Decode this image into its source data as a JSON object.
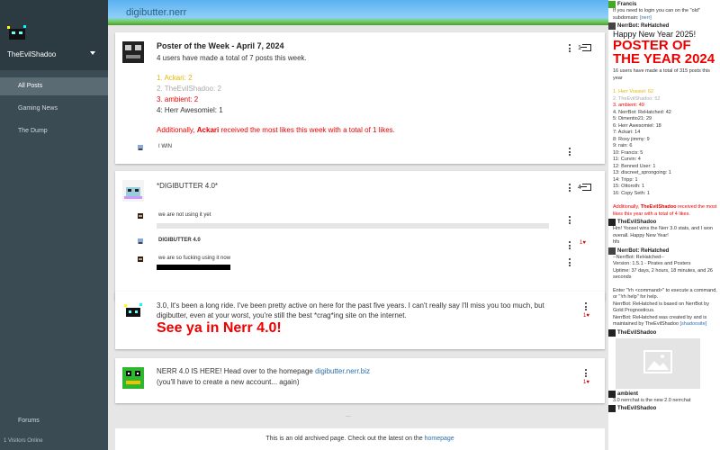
{
  "sidebar": {
    "username": "TheEvilShadoo",
    "nav": [
      {
        "label": "All Posts"
      },
      {
        "label": "Gaming News"
      },
      {
        "label": "The Dump"
      }
    ],
    "forums": "Forums",
    "visitors": "1 Visitors Online"
  },
  "header": {
    "title": "digibutter.nerr"
  },
  "posts": [
    {
      "title": "Poster of the Week - April 7, 2024",
      "intro": "4 users have made a total of 7 posts this week.",
      "rank1": "1. Ackari: 2",
      "rank2": "2. TheEvilShadoo: 2",
      "rank3": "3. ambient: 2",
      "rank4": "4: Herr Awesomiel: 1",
      "most_likes_pre": "Additionally,",
      "most_likes_name": "Ackari",
      "most_likes_post": "received the most likes this week with a total of 1 likes.",
      "share_count": "1",
      "reply_text": "I WIN"
    },
    {
      "title": "*DIGIBUTTER 4.0*",
      "share_count": "4",
      "replies": [
        {
          "text": "we are not using it yet"
        },
        {
          "text": "DIGIBUTTER 4.0",
          "likes": "1"
        },
        {
          "text": "we are so fucking using it now"
        }
      ],
      "more": "..."
    },
    {
      "text": "3.0, It's been a long ride. I've been pretty active on here for the past five years. I can't really say I'll miss you too much, but digibutter, even at your worst, you're still the best *crag*ing site on the internet.",
      "big": "See ya in Nerr 4.0!",
      "likes": "1"
    },
    {
      "text_pre": "NERR 4.0 IS HERE! Head over to the homepage",
      "link": "digibutter.nerr.biz",
      "text2": "(you'll have to create a new account... again)",
      "likes": "1"
    }
  ],
  "feed_more": "...",
  "footer": {
    "text": "This is an old archived page. Check out the latest on the",
    "link": "homepage"
  },
  "chat": {
    "m1_user": "Francis",
    "m1_text": "If you need to login you can on the \"old\" subdomain:",
    "m1_link": "[nerr]",
    "m2_user": "NerrBot: ReHatched",
    "m2_hny": "Happy New Year 2025!",
    "m2_big": "POSTER OF THE YEAR 2024",
    "m2_intro": "16 users have made a total of 315 posts this year",
    "ranks": [
      "1. Herr Vossiel: 62",
      "2. TheEvilShadoo: 52",
      "3. ambient: 49",
      "4. NerrBot: ReHatched: 42",
      "5: Dimentio21: 29",
      "6: Herr Awesomiel: 18",
      "7: Ackari: 14",
      "8: Roxy jimmy: 9",
      "9: rain: 6",
      "10: Francis: 5",
      "11: Curvin: 4",
      "12: Benned User: 1",
      "13: discreet_sprongoing: 1",
      "14: Tripp: 1",
      "15: Ottoroth: 1",
      "16: Copy Seth: 1"
    ],
    "m2_likes_pre": "Additionally,",
    "m2_likes_name": "TheEvilShadoo",
    "m2_likes_post": "received the most likes this year with a total of 4 likes.",
    "m3_user": "TheEvilShadoo",
    "m3_text": "Hm! Yoosel wins the Nerr 3.0 stats, and I won overall. Happy New Year!",
    "m3_text2": "hfs",
    "m4_user": "NerrBot: ReHatched",
    "m4_text": "--NerrBot: ReHatched--",
    "m4_text2": "Version: 1.5.1 - Pirates and Posters",
    "m4_text3": "Uptime: 37 days, 2 hours, 18 minutes, and 26 seconds",
    "m4_text4": "Enter \"!rh <command>\" to execute a command, or \"!rh help\" for help.",
    "m4_text5": "NerrBot: ReHatched is based on NerrBot by Gold Prognosticus.",
    "m4_text6": "NerrBot: ReHatched was created by and is maintained by TheEvilShadoo",
    "m4_link": "[shadoosite]",
    "m5_user": "TheEvilShadoo",
    "m6_user": "ambient",
    "m6_text": "3.0 nerrchat is the new 2.0 nerrchat",
    "m7_user": "TheEvilShadoo"
  },
  "colors": {
    "red": "#e00000",
    "gold": "#e6b800",
    "gray": "#aaaaaa",
    "link": "#2a6fb0"
  }
}
